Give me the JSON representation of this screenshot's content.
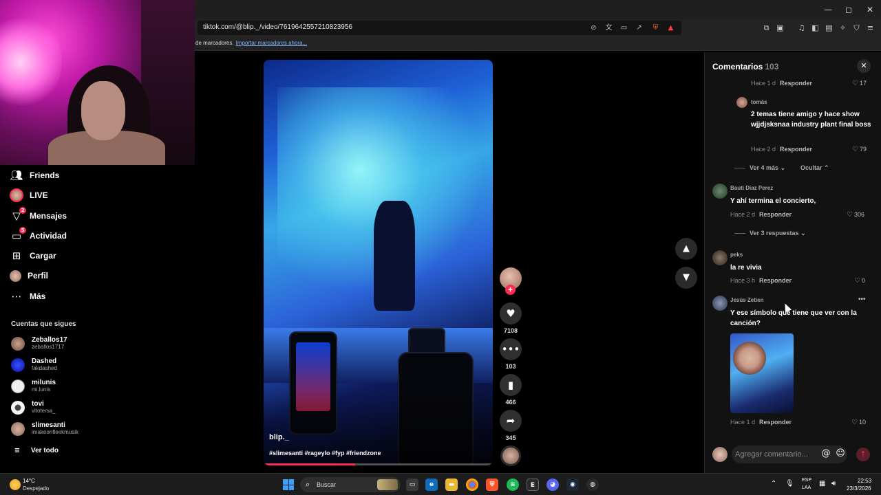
{
  "browser": {
    "url": "tiktok.com/@blip._/video/7619642557210823956",
    "bookmarks_text": "de marcadores.",
    "bookmarks_link": "Importar marcadores ahora..."
  },
  "nav": {
    "items": [
      {
        "label": "Friends",
        "icon": "friends-icon"
      },
      {
        "label": "LIVE",
        "icon": "live-icon"
      },
      {
        "label": "Mensajes",
        "icon": "messages-icon",
        "badge": "2"
      },
      {
        "label": "Actividad",
        "icon": "activity-icon",
        "badge": "5"
      },
      {
        "label": "Cargar",
        "icon": "upload-icon"
      },
      {
        "label": "Perfil",
        "icon": "profile-icon"
      },
      {
        "label": "Más",
        "icon": "more-icon"
      }
    ],
    "following_title": "Cuentas que sigues",
    "accounts": [
      {
        "name": "Zeballos17",
        "user": "zeballos1717",
        "color": "#8a6a55"
      },
      {
        "name": "Dashed",
        "user": "fakdashed",
        "color": "#1a2ce0"
      },
      {
        "name": "milunis",
        "user": "mi.lunis",
        "color": "#e8e8e8"
      },
      {
        "name": "tovi",
        "user": "vitotersa_",
        "color": "#f2f2f2"
      },
      {
        "name": "slimesanti",
        "user": "imakeonfleekmusik",
        "color": "#c49a8a"
      }
    ],
    "see_all": "Ver todo"
  },
  "video": {
    "author": "blip._",
    "hashtags": "#slimesanti #rageylo #fyp #friendzone",
    "progress": 0.4
  },
  "actions": {
    "likes": "7108",
    "comments": "103",
    "saves": "466",
    "shares": "345"
  },
  "comments": {
    "title": "Comentarios",
    "count": "103",
    "reply_label": "Responder",
    "items": [
      {
        "time": "Hace 1 d",
        "likes": "17"
      },
      {
        "name": "tomás",
        "text": "2 temas tiene amigo y hace show wjjdjsksnaa industry plant final boss",
        "time": "Hace 2 d",
        "likes": "79"
      },
      {
        "name": "Bauti Diaz Perez",
        "text": "Y ahí termina el concierto,",
        "time": "Hace 2 d",
        "likes": "306"
      },
      {
        "name": "peks",
        "text": "la re vivia",
        "time": "Hace 3 h",
        "likes": "0"
      },
      {
        "name": "Jesús Zetien",
        "text": "Y ese símbolo que tiene que ver con la canción?",
        "time": "Hace 1 d",
        "likes": "10"
      }
    ],
    "more_replies_1": "Ver 4 más",
    "hide_label": "Ocultar",
    "more_replies_2": "Ver 3 respuestas",
    "input_placeholder": "Agregar comentario..."
  },
  "taskbar": {
    "temp": "14°C",
    "weather": "Despejado",
    "search": "Buscar",
    "lang1": "ESP",
    "lang2": "LAA",
    "time": "22:53",
    "date": "23/3/2026"
  }
}
